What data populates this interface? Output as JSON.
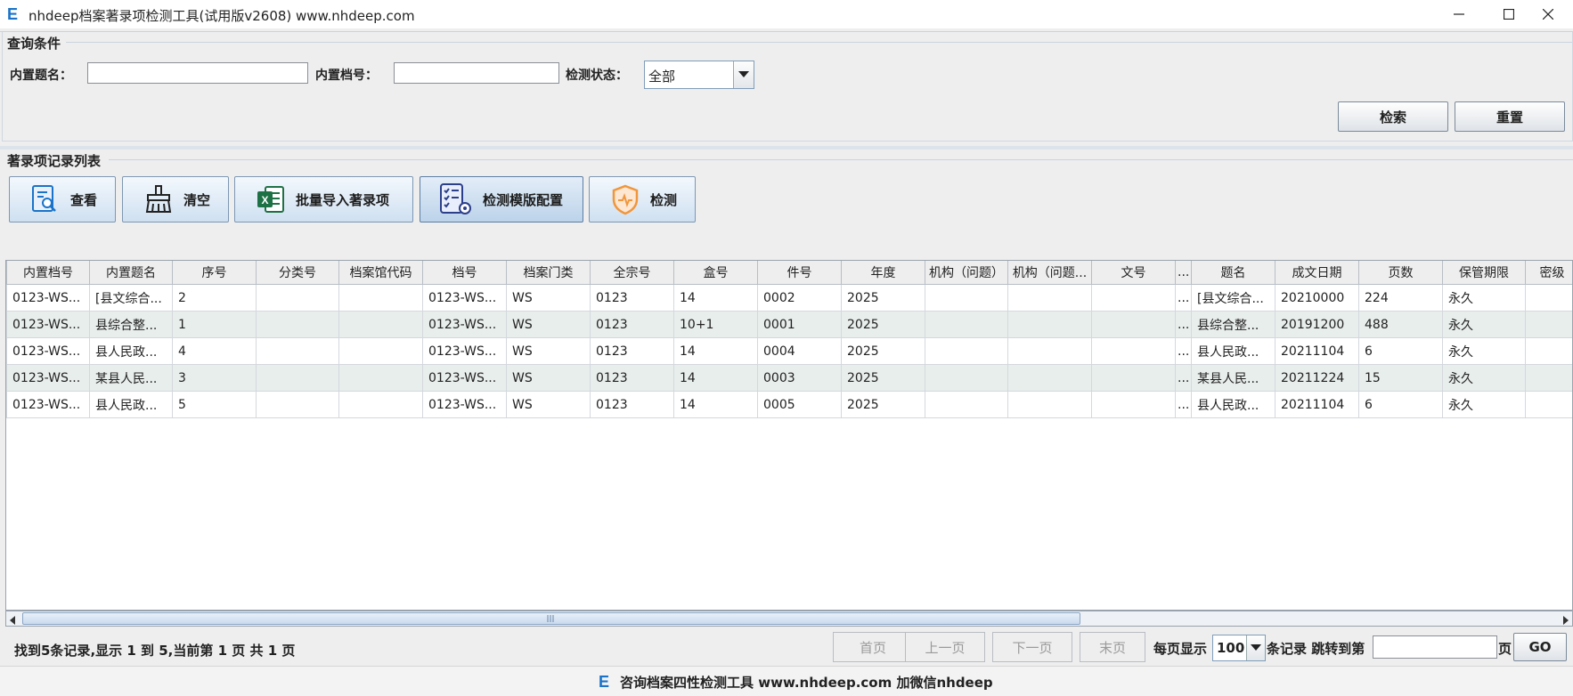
{
  "window": {
    "title": "nhdeep档案著录项检测工具(试用版v2608) www.nhdeep.com",
    "logo_letter": "E"
  },
  "query": {
    "section_title": "查询条件",
    "title_label": "内置题名：",
    "title_value": "",
    "number_label": "内置档号：",
    "number_value": "",
    "status_label": "检测状态：",
    "status_value": "全部",
    "search_button": "检索",
    "reset_button": "重置"
  },
  "records": {
    "section_title": "著录项记录列表",
    "toolbar": {
      "view": "查看",
      "clear": "清空",
      "import": "批量导入著录项",
      "template": "检测模版配置",
      "check": "检测"
    },
    "columns": [
      "内置档号",
      "内置题名",
      "序号",
      "分类号",
      "档案馆代码",
      "档号",
      "档案门类",
      "全宗号",
      "盒号",
      "件号",
      "年度",
      "机构（问题）",
      "机构（问题...",
      "文号",
      "...",
      "题名",
      "成文日期",
      "页数",
      "保管期限",
      "密级"
    ],
    "rows": [
      [
        "0123-WS...",
        "[县文综合...",
        "2",
        "",
        "",
        "0123-WS...",
        "WS",
        "0123",
        "14",
        "0002",
        "2025",
        "",
        "",
        "",
        "...",
        "[县文综合...",
        "20210000",
        "224",
        "永久",
        ""
      ],
      [
        "0123-WS...",
        "县综合整...",
        "1",
        "",
        "",
        "0123-WS...",
        "WS",
        "0123",
        "10+1",
        "0001",
        "2025",
        "",
        "",
        "",
        "...",
        "县综合整...",
        "20191200",
        "488",
        "永久",
        ""
      ],
      [
        "0123-WS...",
        "县人民政...",
        "4",
        "",
        "",
        "0123-WS...",
        "WS",
        "0123",
        "14",
        "0004",
        "2025",
        "",
        "",
        "",
        "...",
        "县人民政...",
        "20211104",
        "6",
        "永久",
        ""
      ],
      [
        "0123-WS...",
        "某县人民...",
        "3",
        "",
        "",
        "0123-WS...",
        "WS",
        "0123",
        "14",
        "0003",
        "2025",
        "",
        "",
        "",
        "...",
        "某县人民...",
        "20211224",
        "15",
        "永久",
        ""
      ],
      [
        "0123-WS...",
        "县人民政...",
        "5",
        "",
        "",
        "0123-WS...",
        "WS",
        "0123",
        "14",
        "0005",
        "2025",
        "",
        "",
        "",
        "...",
        "县人民政...",
        "20211104",
        "6",
        "永久",
        ""
      ]
    ]
  },
  "pagination": {
    "status": "找到5条记录,显示 1 到 5,当前第 1 页 共 1 页",
    "first": "首页",
    "prev": "上一页",
    "next": "下一页",
    "last": "末页",
    "per_page_label": "每页显示",
    "per_page_value": "100",
    "records_jump_label": "条记录 跳转到第",
    "page_input_value": "",
    "page_suffix": "页",
    "go": "GO"
  },
  "footer": {
    "text": "咨询档案四性检测工具 www.nhdeep.com 加微信nhdeep"
  },
  "colors": {
    "accent": "#1a73c8",
    "row_alt": "#e8eeec",
    "excel_green": "#1e7145",
    "orange_shield": "#f0963c"
  }
}
